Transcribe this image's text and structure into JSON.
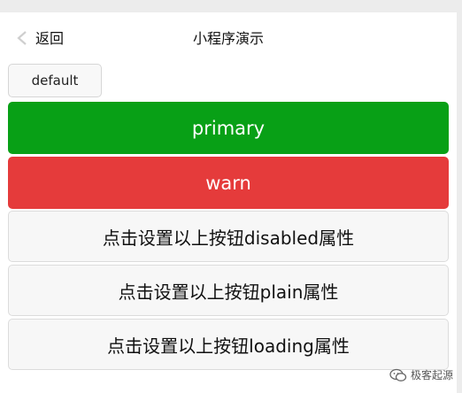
{
  "navbar": {
    "back_label": "返回",
    "title": "小程序演示"
  },
  "buttons": {
    "default": "default",
    "primary": "primary",
    "warn": "warn",
    "toggle_disabled": "点击设置以上按钮disabled属性",
    "toggle_plain": "点击设置以上按钮plain属性",
    "toggle_loading": "点击设置以上按钮loading属性"
  },
  "watermark": {
    "text": "极客起源",
    "icon": "wechat-icon"
  },
  "colors": {
    "primary": "#08a016",
    "warn": "#e53b3b",
    "default_bg": "#f8f8f8"
  }
}
